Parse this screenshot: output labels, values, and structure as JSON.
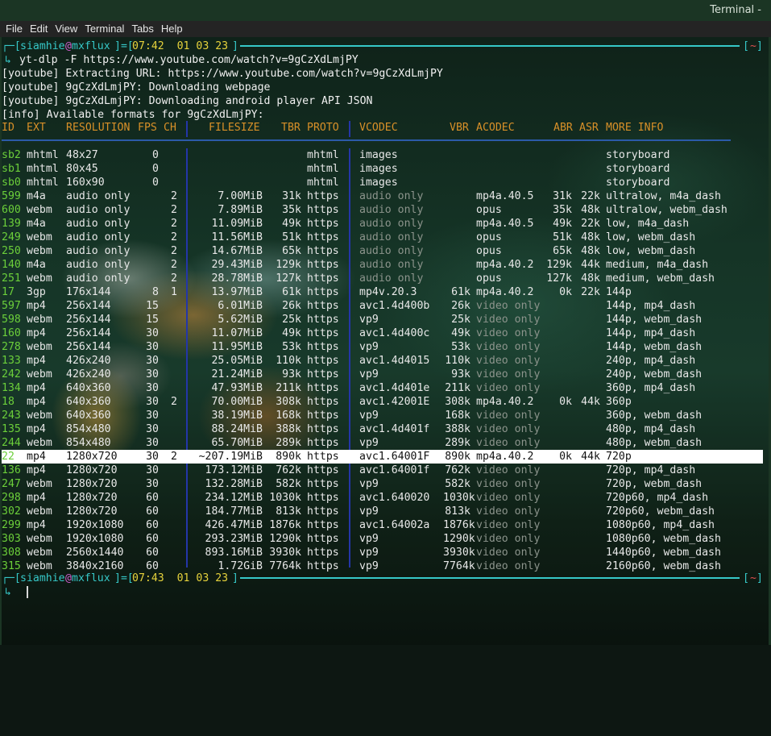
{
  "window": {
    "title": "Terminal -"
  },
  "menu": [
    "File",
    "Edit",
    "View",
    "Terminal",
    "Tabs",
    "Help"
  ],
  "prompt1": {
    "user": "siamhie",
    "at": "@",
    "host": "mxflux",
    "time": "07:42  01 03 23",
    "tilde": "~",
    "arrow": "↳",
    "command": " yt-dlp -F https://www.youtube.com/watch?v=9gCzXdLmjPY"
  },
  "log": [
    "[youtube] Extracting URL: https://www.youtube.com/watch?v=9gCzXdLmjPY",
    "[youtube] 9gCzXdLmjPY: Downloading webpage",
    "[youtube] 9gCzXdLmjPY: Downloading android player API JSON",
    "[info] Available formats for 9gCzXdLmjPY:"
  ],
  "headers": {
    "id": "ID",
    "ext": "EXT",
    "res": "RESOLUTION",
    "fps": "FPS",
    "ch": "CH",
    "size": "FILESIZE",
    "tbr": "TBR",
    "proto": "PROTO",
    "vcodec": "VCODEC",
    "vbr": "VBR",
    "acodec": "ACODEC",
    "abr": "ABR",
    "asr": "ASR",
    "more": "MORE INFO"
  },
  "formats": [
    {
      "id": "sb2",
      "ext": "mhtml",
      "res": "48x27",
      "fps": "0",
      "ch": "",
      "size": "",
      "tbr": "",
      "proto": "mhtml",
      "vcodec": "images",
      "vbr": "",
      "acodec": "",
      "abr": "",
      "asr": "",
      "more": "storyboard"
    },
    {
      "id": "sb1",
      "ext": "mhtml",
      "res": "80x45",
      "fps": "0",
      "ch": "",
      "size": "",
      "tbr": "",
      "proto": "mhtml",
      "vcodec": "images",
      "vbr": "",
      "acodec": "",
      "abr": "",
      "asr": "",
      "more": "storyboard"
    },
    {
      "id": "sb0",
      "ext": "mhtml",
      "res": "160x90",
      "fps": "0",
      "ch": "",
      "size": "",
      "tbr": "",
      "proto": "mhtml",
      "vcodec": "images",
      "vbr": "",
      "acodec": "",
      "abr": "",
      "asr": "",
      "more": "storyboard"
    },
    {
      "id": "599",
      "ext": "m4a",
      "res": "audio only",
      "fps": "",
      "ch": "2",
      "size": "7.00MiB",
      "tbr": "31k",
      "proto": "https",
      "vcodec": "audio only",
      "vbr": "",
      "acodec": "mp4a.40.5",
      "abr": "31k",
      "asr": "22k",
      "more": "ultralow, m4a_dash"
    },
    {
      "id": "600",
      "ext": "webm",
      "res": "audio only",
      "fps": "",
      "ch": "2",
      "size": "7.89MiB",
      "tbr": "35k",
      "proto": "https",
      "vcodec": "audio only",
      "vbr": "",
      "acodec": "opus",
      "abr": "35k",
      "asr": "48k",
      "more": "ultralow, webm_dash"
    },
    {
      "id": "139",
      "ext": "m4a",
      "res": "audio only",
      "fps": "",
      "ch": "2",
      "size": "11.09MiB",
      "tbr": "49k",
      "proto": "https",
      "vcodec": "audio only",
      "vbr": "",
      "acodec": "mp4a.40.5",
      "abr": "49k",
      "asr": "22k",
      "more": "low, m4a_dash"
    },
    {
      "id": "249",
      "ext": "webm",
      "res": "audio only",
      "fps": "",
      "ch": "2",
      "size": "11.56MiB",
      "tbr": "51k",
      "proto": "https",
      "vcodec": "audio only",
      "vbr": "",
      "acodec": "opus",
      "abr": "51k",
      "asr": "48k",
      "more": "low, webm_dash"
    },
    {
      "id": "250",
      "ext": "webm",
      "res": "audio only",
      "fps": "",
      "ch": "2",
      "size": "14.67MiB",
      "tbr": "65k",
      "proto": "https",
      "vcodec": "audio only",
      "vbr": "",
      "acodec": "opus",
      "abr": "65k",
      "asr": "48k",
      "more": "low, webm_dash"
    },
    {
      "id": "140",
      "ext": "m4a",
      "res": "audio only",
      "fps": "",
      "ch": "2",
      "size": "29.43MiB",
      "tbr": "129k",
      "proto": "https",
      "vcodec": "audio only",
      "vbr": "",
      "acodec": "mp4a.40.2",
      "abr": "129k",
      "asr": "44k",
      "more": "medium, m4a_dash"
    },
    {
      "id": "251",
      "ext": "webm",
      "res": "audio only",
      "fps": "",
      "ch": "2",
      "size": "28.78MiB",
      "tbr": "127k",
      "proto": "https",
      "vcodec": "audio only",
      "vbr": "",
      "acodec": "opus",
      "abr": "127k",
      "asr": "48k",
      "more": "medium, webm_dash"
    },
    {
      "id": "17",
      "ext": "3gp",
      "res": "176x144",
      "fps": "8",
      "ch": "1",
      "size": "13.97MiB",
      "tbr": "61k",
      "proto": "https",
      "vcodec": "mp4v.20.3",
      "vbr": "61k",
      "acodec": "mp4a.40.2",
      "abr": "0k",
      "asr": "22k",
      "more": "144p"
    },
    {
      "id": "597",
      "ext": "mp4",
      "res": "256x144",
      "fps": "15",
      "ch": "",
      "size": "6.01MiB",
      "tbr": "26k",
      "proto": "https",
      "vcodec": "avc1.4d400b",
      "vbr": "26k",
      "acodec": "video only",
      "abr": "",
      "asr": "",
      "more": "144p, mp4_dash"
    },
    {
      "id": "598",
      "ext": "webm",
      "res": "256x144",
      "fps": "15",
      "ch": "",
      "size": "5.62MiB",
      "tbr": "25k",
      "proto": "https",
      "vcodec": "vp9",
      "vbr": "25k",
      "acodec": "video only",
      "abr": "",
      "asr": "",
      "more": "144p, webm_dash"
    },
    {
      "id": "160",
      "ext": "mp4",
      "res": "256x144",
      "fps": "30",
      "ch": "",
      "size": "11.07MiB",
      "tbr": "49k",
      "proto": "https",
      "vcodec": "avc1.4d400c",
      "vbr": "49k",
      "acodec": "video only",
      "abr": "",
      "asr": "",
      "more": "144p, mp4_dash"
    },
    {
      "id": "278",
      "ext": "webm",
      "res": "256x144",
      "fps": "30",
      "ch": "",
      "size": "11.95MiB",
      "tbr": "53k",
      "proto": "https",
      "vcodec": "vp9",
      "vbr": "53k",
      "acodec": "video only",
      "abr": "",
      "asr": "",
      "more": "144p, webm_dash"
    },
    {
      "id": "133",
      "ext": "mp4",
      "res": "426x240",
      "fps": "30",
      "ch": "",
      "size": "25.05MiB",
      "tbr": "110k",
      "proto": "https",
      "vcodec": "avc1.4d4015",
      "vbr": "110k",
      "acodec": "video only",
      "abr": "",
      "asr": "",
      "more": "240p, mp4_dash"
    },
    {
      "id": "242",
      "ext": "webm",
      "res": "426x240",
      "fps": "30",
      "ch": "",
      "size": "21.24MiB",
      "tbr": "93k",
      "proto": "https",
      "vcodec": "vp9",
      "vbr": "93k",
      "acodec": "video only",
      "abr": "",
      "asr": "",
      "more": "240p, webm_dash"
    },
    {
      "id": "134",
      "ext": "mp4",
      "res": "640x360",
      "fps": "30",
      "ch": "",
      "size": "47.93MiB",
      "tbr": "211k",
      "proto": "https",
      "vcodec": "avc1.4d401e",
      "vbr": "211k",
      "acodec": "video only",
      "abr": "",
      "asr": "",
      "more": "360p, mp4_dash"
    },
    {
      "id": "18",
      "ext": "mp4",
      "res": "640x360",
      "fps": "30",
      "ch": "2",
      "size": "70.00MiB",
      "tbr": "308k",
      "proto": "https",
      "vcodec": "avc1.42001E",
      "vbr": "308k",
      "acodec": "mp4a.40.2",
      "abr": "0k",
      "asr": "44k",
      "more": "360p"
    },
    {
      "id": "243",
      "ext": "webm",
      "res": "640x360",
      "fps": "30",
      "ch": "",
      "size": "38.19MiB",
      "tbr": "168k",
      "proto": "https",
      "vcodec": "vp9",
      "vbr": "168k",
      "acodec": "video only",
      "abr": "",
      "asr": "",
      "more": "360p, webm_dash"
    },
    {
      "id": "135",
      "ext": "mp4",
      "res": "854x480",
      "fps": "30",
      "ch": "",
      "size": "88.24MiB",
      "tbr": "388k",
      "proto": "https",
      "vcodec": "avc1.4d401f",
      "vbr": "388k",
      "acodec": "video only",
      "abr": "",
      "asr": "",
      "more": "480p, mp4_dash"
    },
    {
      "id": "244",
      "ext": "webm",
      "res": "854x480",
      "fps": "30",
      "ch": "",
      "size": "65.70MiB",
      "tbr": "289k",
      "proto": "https",
      "vcodec": "vp9",
      "vbr": "289k",
      "acodec": "video only",
      "abr": "",
      "asr": "",
      "more": "480p, webm_dash"
    },
    {
      "id": "22",
      "ext": "mp4",
      "res": "1280x720",
      "fps": "30",
      "ch": "2",
      "size": "~207.19MiB",
      "tbr": "890k",
      "proto": "https",
      "vcodec": "avc1.64001F",
      "vbr": "890k",
      "acodec": "mp4a.40.2",
      "abr": "0k",
      "asr": "44k",
      "more": "720p",
      "selected": true
    },
    {
      "id": "136",
      "ext": "mp4",
      "res": "1280x720",
      "fps": "30",
      "ch": "",
      "size": "173.12MiB",
      "tbr": "762k",
      "proto": "https",
      "vcodec": "avc1.64001f",
      "vbr": "762k",
      "acodec": "video only",
      "abr": "",
      "asr": "",
      "more": "720p, mp4_dash"
    },
    {
      "id": "247",
      "ext": "webm",
      "res": "1280x720",
      "fps": "30",
      "ch": "",
      "size": "132.28MiB",
      "tbr": "582k",
      "proto": "https",
      "vcodec": "vp9",
      "vbr": "582k",
      "acodec": "video only",
      "abr": "",
      "asr": "",
      "more": "720p, webm_dash"
    },
    {
      "id": "298",
      "ext": "mp4",
      "res": "1280x720",
      "fps": "60",
      "ch": "",
      "size": "234.12MiB",
      "tbr": "1030k",
      "proto": "https",
      "vcodec": "avc1.640020",
      "vbr": "1030k",
      "acodec": "video only",
      "abr": "",
      "asr": "",
      "more": "720p60, mp4_dash"
    },
    {
      "id": "302",
      "ext": "webm",
      "res": "1280x720",
      "fps": "60",
      "ch": "",
      "size": "184.77MiB",
      "tbr": "813k",
      "proto": "https",
      "vcodec": "vp9",
      "vbr": "813k",
      "acodec": "video only",
      "abr": "",
      "asr": "",
      "more": "720p60, webm_dash"
    },
    {
      "id": "299",
      "ext": "mp4",
      "res": "1920x1080",
      "fps": "60",
      "ch": "",
      "size": "426.47MiB",
      "tbr": "1876k",
      "proto": "https",
      "vcodec": "avc1.64002a",
      "vbr": "1876k",
      "acodec": "video only",
      "abr": "",
      "asr": "",
      "more": "1080p60, mp4_dash"
    },
    {
      "id": "303",
      "ext": "webm",
      "res": "1920x1080",
      "fps": "60",
      "ch": "",
      "size": "293.23MiB",
      "tbr": "1290k",
      "proto": "https",
      "vcodec": "vp9",
      "vbr": "1290k",
      "acodec": "video only",
      "abr": "",
      "asr": "",
      "more": "1080p60, webm_dash"
    },
    {
      "id": "308",
      "ext": "webm",
      "res": "2560x1440",
      "fps": "60",
      "ch": "",
      "size": "893.16MiB",
      "tbr": "3930k",
      "proto": "https",
      "vcodec": "vp9",
      "vbr": "3930k",
      "acodec": "video only",
      "abr": "",
      "asr": "",
      "more": "1440p60, webm_dash"
    },
    {
      "id": "315",
      "ext": "webm",
      "res": "3840x2160",
      "fps": "60",
      "ch": "",
      "size": "1.72GiB",
      "tbr": "7764k",
      "proto": "https",
      "vcodec": "vp9",
      "vbr": "7764k",
      "acodec": "video only",
      "abr": "",
      "asr": "",
      "more": "2160p60, webm_dash"
    }
  ],
  "prompt2": {
    "user": "siamhie",
    "at": "@",
    "host": "mxflux",
    "time": "07:43  01 03 23",
    "tilde": "~",
    "arrow": "↳"
  },
  "colors": {
    "id": "#6ccf3a",
    "header": "#d89028",
    "dim": "#8c948c",
    "cyan": "#36c8c8",
    "separator": "#2b5aa8",
    "highlight": "#ffffff"
  }
}
